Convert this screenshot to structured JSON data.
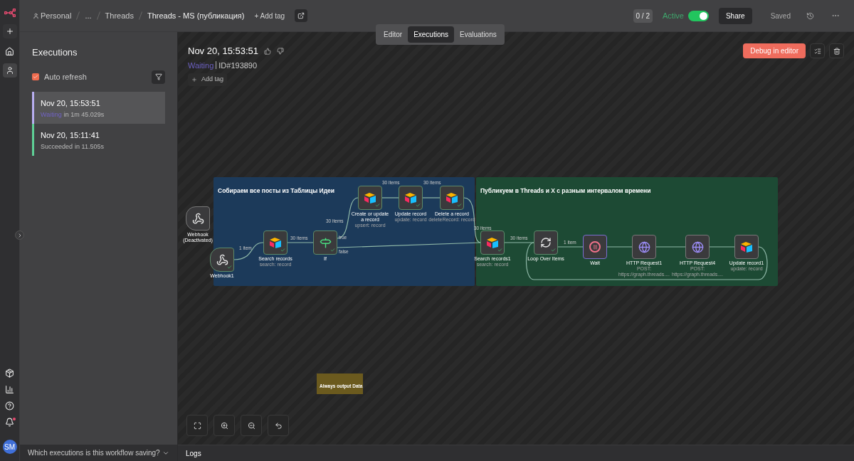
{
  "header": {
    "breadcrumbs": [
      "Personal",
      "...",
      "Threads"
    ],
    "title": "Threads - MS (публикация)",
    "add_tag": "+ Add tag",
    "counter": "0 / 2",
    "active": {
      "label": "Active",
      "on": true
    },
    "share": "Share",
    "saved": "Saved"
  },
  "view_tabs": [
    {
      "label": "Editor",
      "selected": false
    },
    {
      "label": "Executions",
      "selected": true
    },
    {
      "label": "Evaluations",
      "selected": false
    }
  ],
  "executions": {
    "title": "Executions",
    "auto_refresh": {
      "label": "Auto refresh",
      "checked": true
    },
    "items": [
      {
        "time": "Nov 20, 15:53:51",
        "status": "Waiting",
        "detail": "in 1m 45.029s",
        "kind": "waiting",
        "selected": true
      },
      {
        "time": "Nov 20, 15:11:41",
        "status": "Succeeded",
        "detail": "in 11.505s",
        "kind": "success",
        "selected": false
      }
    ],
    "footer": "Which executions is this workflow saving?"
  },
  "execution": {
    "time": "Nov 20, 15:53:51",
    "status": "Waiting",
    "id": "ID#193890",
    "add_tag": "Add tag",
    "debug": "Debug in editor"
  },
  "canvas": {
    "groups": [
      {
        "title": "Собираем все посты из Таблицы Идеи",
        "color": "#1c3a5a"
      },
      {
        "title": "Публикуем в Threads и X с разным интервалом времени",
        "color": "#1d4a34"
      }
    ],
    "nodes": [
      {
        "name": "Webhook (Deactivated)",
        "kind": "webhook",
        "executed": false,
        "waiting": false
      },
      {
        "name": "Webhook1",
        "kind": "webhook",
        "executed": true,
        "waiting": false
      },
      {
        "name": "Search records",
        "subtitle": "search: record",
        "kind": "airtable",
        "executed": true,
        "waiting": false
      },
      {
        "name": "If",
        "kind": "if",
        "executed": true,
        "waiting": false
      },
      {
        "name": "Create or update a record",
        "subtitle": "upsert: record",
        "kind": "airtable",
        "executed": true,
        "waiting": false
      },
      {
        "name": "Update record",
        "subtitle": "update: record",
        "kind": "airtable",
        "executed": true,
        "waiting": false
      },
      {
        "name": "Delete a record",
        "subtitle": "deleteRecord: record",
        "kind": "airtable",
        "executed": true,
        "waiting": false
      },
      {
        "name": "Search records1",
        "subtitle": "search: record",
        "kind": "airtable",
        "executed": true,
        "waiting": false
      },
      {
        "name": "Loop Over Items",
        "kind": "loop",
        "executed": true,
        "waiting": false
      },
      {
        "name": "Wait",
        "kind": "wait",
        "executed": false,
        "waiting": true
      },
      {
        "name": "HTTP Request1",
        "subtitle": "POST: https://graph.threads....",
        "kind": "http",
        "executed": false,
        "waiting": false
      },
      {
        "name": "HTTP Request4",
        "subtitle": "POST: https://graph.threads....",
        "kind": "http",
        "executed": false,
        "waiting": false
      },
      {
        "name": "Update record1",
        "subtitle": "update: record",
        "kind": "airtable",
        "executed": false,
        "waiting": false
      }
    ],
    "edge_labels": [
      "1 item",
      "30 items",
      "30 items",
      "30 items",
      "30 items",
      "30 items",
      "30 items",
      "1 item",
      "true",
      "false"
    ],
    "sticky": "Always output Data"
  },
  "logs": "Logs",
  "avatar": "SM"
}
